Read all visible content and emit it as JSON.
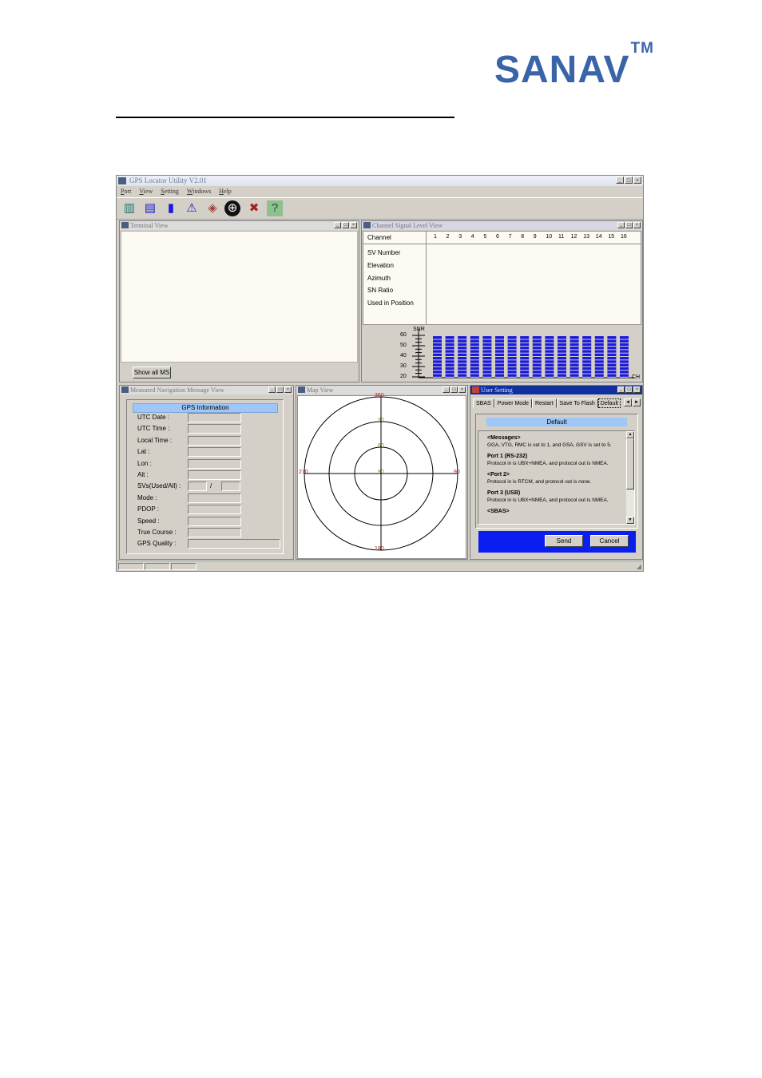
{
  "logo": {
    "text": "SANAV",
    "mark": "TM",
    "color": "#3a64a8"
  },
  "app": {
    "title": "GPS Locator Utility V2.01",
    "menu": [
      "Port",
      "View",
      "Setting",
      "Windows",
      "Help"
    ],
    "window_buttons": [
      "_",
      "□",
      "×"
    ],
    "toolbar_icons": [
      "connect-icon",
      "ascii-binary-icon",
      "signal-bars-icon",
      "navigation-icon",
      "map-icon",
      "target-icon",
      "tools-icon",
      "help-icon"
    ],
    "toolbar_glyphs": [
      "▥",
      "▤",
      "▮",
      "⚠",
      "◈",
      "⊕",
      "✖",
      "?"
    ]
  },
  "terminal": {
    "title": "Terminal View",
    "show_button": "Show all MS"
  },
  "channel": {
    "title": "Channel Signal Level View",
    "header": "Channel",
    "channels": [
      "1",
      "2",
      "3",
      "4",
      "5",
      "6",
      "7",
      "8",
      "9",
      "10",
      "11",
      "12",
      "13",
      "14",
      "15",
      "16"
    ],
    "rows": [
      "SV Number",
      "Elevation",
      "Azimuth",
      "SN Ratio",
      "Used in Position"
    ],
    "snr_label": "SNR",
    "ch_label": "CH",
    "snr_ticks": [
      "60",
      "50",
      "40",
      "30",
      "20"
    ]
  },
  "nav": {
    "title": "Measured Navigation Message View",
    "header": "GPS Information",
    "fields": [
      "UTC Date :",
      "UTC Time :",
      "Local Time :",
      "Lat :",
      "Lon :",
      "Alt :",
      "SVs(Used/All) :",
      "Mode :",
      "PDOP :",
      "Speed :",
      "True Course :",
      "GPS Quality :"
    ],
    "svs_separator": "/"
  },
  "map": {
    "title": "Map View",
    "labels": {
      "top": "360",
      "bottom": "180",
      "left": "270",
      "right": "90",
      "ring1": "30",
      "ring2": "60",
      "center": "90"
    }
  },
  "user": {
    "title": "User Setting",
    "tabs": [
      "SBAS",
      "Power Mode",
      "Restart",
      "Save To Flash",
      "Default"
    ],
    "tab_arrows": [
      "◄",
      "►"
    ],
    "default_button": "Default",
    "content": [
      {
        "heading": "<Messages>",
        "text": "GGA, VTG, RMC is set to 1, and GSA, GSV is set to 5."
      },
      {
        "heading": "Port 1 (RS-232)",
        "text": "Protocol in is UBX+NMEA, and protocol out is NMEA."
      },
      {
        "heading": "<Port 2>",
        "text": "Protocol in is RTCM, and protocol out is none."
      },
      {
        "heading": "Port 3 (USB)",
        "text": "Protocol in is UBX+NMEA, and protocol out is NMEA."
      },
      {
        "heading": "<SBAS>",
        "text": ""
      }
    ],
    "send": "Send",
    "cancel": "Cancel"
  },
  "colors": {
    "bar_blue": "#1a1ad8",
    "panel_blue": "#0a1ef0",
    "header_blue": "#9ec6f7",
    "ring_red": "#a02020"
  }
}
